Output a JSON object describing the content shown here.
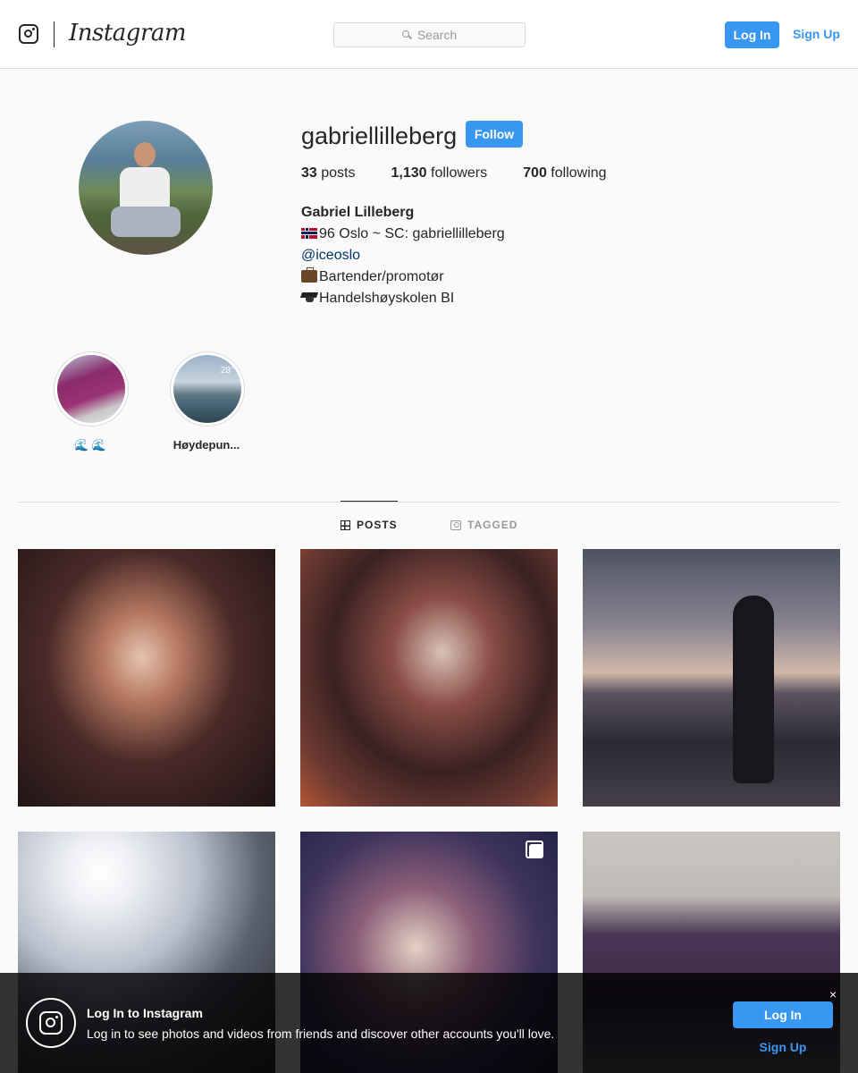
{
  "header": {
    "brand": "Instagram",
    "search_placeholder": "Search",
    "login_label": "Log In",
    "signup_label": "Sign Up"
  },
  "profile": {
    "username": "gabriellilleberg",
    "follow_label": "Follow",
    "stats": {
      "posts_count": "33",
      "posts_label": "posts",
      "followers_count": "1,130",
      "followers_label": "followers",
      "following_count": "700",
      "following_label": "following"
    },
    "full_name": "Gabriel Lilleberg",
    "bio": {
      "line1": "96 Oslo ~ SC: gabriellilleberg",
      "mention": "@iceoslo",
      "line3": "Bartender/promotør",
      "line4": "Handelshøyskolen BI"
    }
  },
  "highlights": [
    {
      "label": "🌊 🌊"
    },
    {
      "label": "Høydepun...",
      "overlay_text": "28°"
    }
  ],
  "tabs": [
    {
      "label": "POSTS",
      "icon": "grid-icon",
      "active": true
    },
    {
      "label": "TAGGED",
      "icon": "tagged-icon",
      "active": false
    }
  ],
  "login_banner": {
    "title": "Log In to Instagram",
    "text": "Log in to see photos and videos from friends and discover other accounts you'll love.",
    "close_label": "×",
    "login_label": "Log In",
    "signup_label": "Sign Up"
  },
  "colors": {
    "accent": "#3897f0",
    "mention": "#003569",
    "text": "#262626",
    "background": "#fafafa"
  }
}
